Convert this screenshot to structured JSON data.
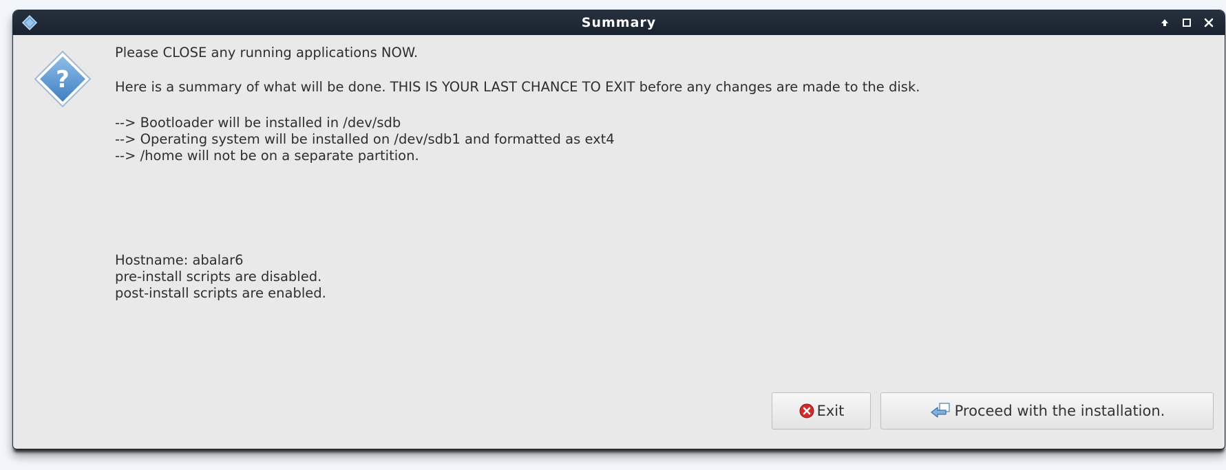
{
  "window": {
    "title": "Summary"
  },
  "message": {
    "close_apps": "Please CLOSE any running applications NOW.",
    "summary_intro": "Here is a summary of what will be done. THIS IS YOUR LAST CHANCE TO EXIT before any changes are made to the disk.",
    "actions": [
      "--> Bootloader will be installed in /dev/sdb",
      "--> Operating system will be installed on /dev/sdb1 and formatted as ext4",
      "--> /home will not be on a separate partition."
    ],
    "details": [
      "Hostname: abalar6",
      "pre-install scripts are disabled.",
      "post-install scripts are enabled."
    ]
  },
  "buttons": {
    "exit_label": "Exit",
    "proceed_label": "Proceed with the installation."
  },
  "icons": {
    "window_logo": "diamond-logo-icon",
    "dialog": "question-icon",
    "exit": "exit-icon",
    "proceed": "proceed-arrow-icon",
    "titlebar_controls": [
      "minimize-icon",
      "maximize-icon",
      "close-icon"
    ]
  },
  "colors": {
    "titlebar": "#1f2835",
    "dialog_background": "#e9e9e9",
    "question_icon": "#4a86c8",
    "exit_icon": "#d12b2b",
    "text": "#2e2e2e"
  }
}
